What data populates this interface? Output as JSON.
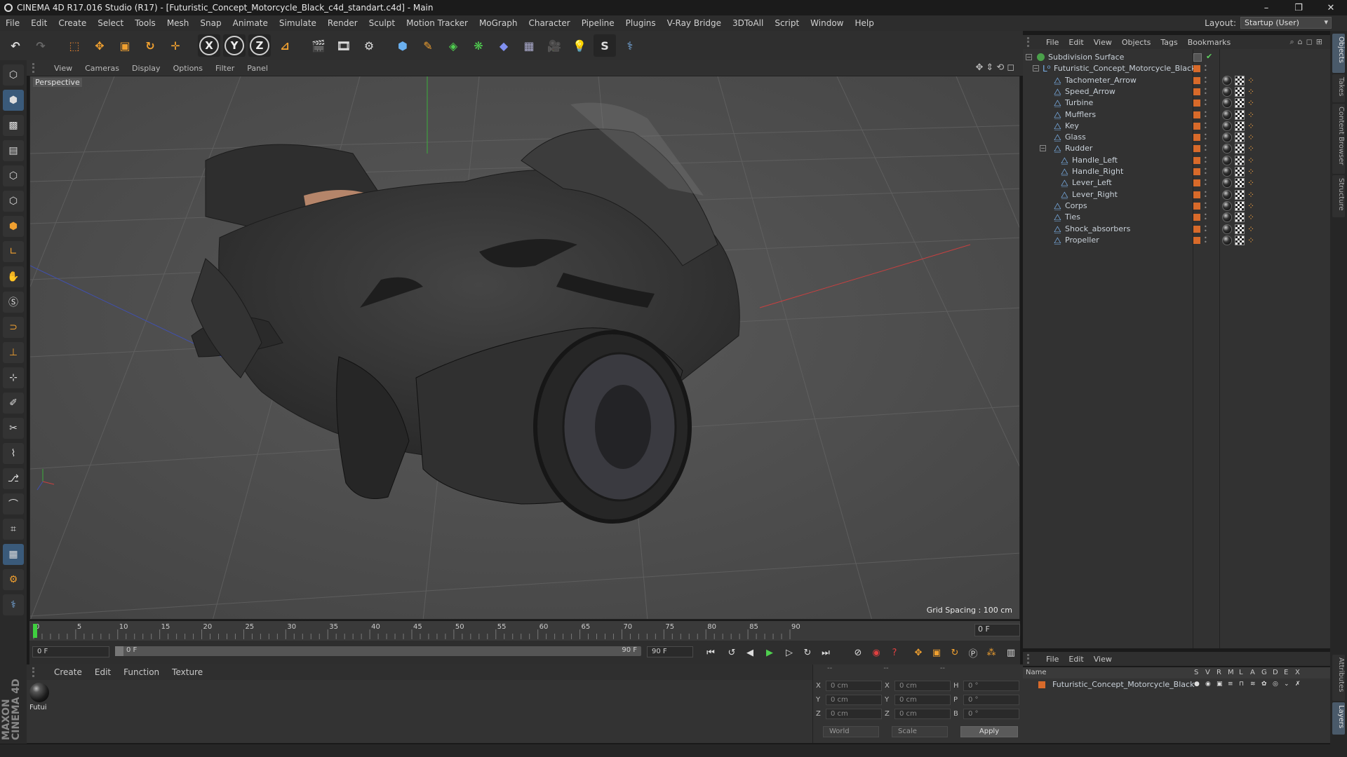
{
  "window": {
    "title": "CINEMA 4D R17.016 Studio (R17) - [Futuristic_Concept_Motorcycle_Black_c4d_standart.c4d] - Main",
    "controls": [
      "–",
      "❐",
      "✕"
    ]
  },
  "menu": [
    "File",
    "Edit",
    "Create",
    "Select",
    "Tools",
    "Mesh",
    "Snap",
    "Animate",
    "Simulate",
    "Render",
    "Sculpt",
    "Motion Tracker",
    "MoGraph",
    "Character",
    "Pipeline",
    "Plugins",
    "V-Ray Bridge",
    "3DToAll",
    "Script",
    "Window",
    "Help"
  ],
  "layout": {
    "label": "Layout:",
    "value": "Startup (User)"
  },
  "toolbar": {
    "axis_x": "X",
    "axis_y": "Y",
    "axis_z": "Z"
  },
  "viewport": {
    "menu": [
      "View",
      "Cameras",
      "Display",
      "Options",
      "Filter",
      "Panel"
    ],
    "label": "Perspective",
    "grid_spacing": "Grid Spacing : 100 cm"
  },
  "timeline": {
    "ticks": [
      "0",
      "5",
      "10",
      "15",
      "20",
      "25",
      "30",
      "35",
      "40",
      "45",
      "50",
      "55",
      "60",
      "65",
      "70",
      "75",
      "80",
      "85",
      "90"
    ],
    "current_frame_end": "0 F",
    "start_field": "0 F",
    "slider_start": "0 F",
    "slider_end": "90 F",
    "end_field": "90 F"
  },
  "material_manager": {
    "menu": [
      "Create",
      "Edit",
      "Function",
      "Texture"
    ],
    "material_name": "Futui"
  },
  "coordinates": {
    "header": [
      "--",
      "--",
      "--"
    ],
    "rows": [
      {
        "l1": "X",
        "v1": "0 cm",
        "l2": "X",
        "v2": "0 cm",
        "l3": "H",
        "v3": "0 °"
      },
      {
        "l1": "Y",
        "v1": "0 cm",
        "l2": "Y",
        "v2": "0 cm",
        "l3": "P",
        "v3": "0 °"
      },
      {
        "l1": "Z",
        "v1": "0 cm",
        "l2": "Z",
        "v2": "0 cm",
        "l3": "B",
        "v3": "0 °"
      }
    ],
    "mode": "World",
    "transform": "Scale",
    "apply": "Apply"
  },
  "object_manager": {
    "menu": [
      "File",
      "Edit",
      "View",
      "Objects",
      "Tags",
      "Bookmarks"
    ],
    "objects": [
      {
        "name": "Subdivision Surface",
        "level": 0,
        "type": "subdivision"
      },
      {
        "name": "Futuristic_Concept_Motorcycle_Black",
        "level": 1,
        "type": "null"
      },
      {
        "name": "Tachometer_Arrow",
        "level": 2,
        "type": "poly"
      },
      {
        "name": "Speed_Arrow",
        "level": 2,
        "type": "poly"
      },
      {
        "name": "Turbine",
        "level": 2,
        "type": "poly"
      },
      {
        "name": "Mufflers",
        "level": 2,
        "type": "poly"
      },
      {
        "name": "Key",
        "level": 2,
        "type": "poly"
      },
      {
        "name": "Glass",
        "level": 2,
        "type": "poly"
      },
      {
        "name": "Rudder",
        "level": 2,
        "type": "poly"
      },
      {
        "name": "Handle_Left",
        "level": 3,
        "type": "poly"
      },
      {
        "name": "Handle_Right",
        "level": 3,
        "type": "poly"
      },
      {
        "name": "Lever_Left",
        "level": 3,
        "type": "poly"
      },
      {
        "name": "Lever_Right",
        "level": 3,
        "type": "poly"
      },
      {
        "name": "Corps",
        "level": 2,
        "type": "poly"
      },
      {
        "name": "Ties",
        "level": 2,
        "type": "poly"
      },
      {
        "name": "Shock_absorbers",
        "level": 2,
        "type": "poly"
      },
      {
        "name": "Propeller",
        "level": 2,
        "type": "poly"
      }
    ]
  },
  "layer_manager": {
    "menu": [
      "File",
      "Edit",
      "View"
    ],
    "columns": [
      "Name",
      "S",
      "V",
      "R",
      "M",
      "L",
      "A",
      "G",
      "D",
      "E",
      "X"
    ],
    "layer_name": "Futuristic_Concept_Motorcycle_Black"
  },
  "right_tabs": [
    "Objects",
    "Takes",
    "Content Browser",
    "Structure",
    "Attributes",
    "Layers"
  ],
  "branding": "MAXON CINEMA 4D"
}
